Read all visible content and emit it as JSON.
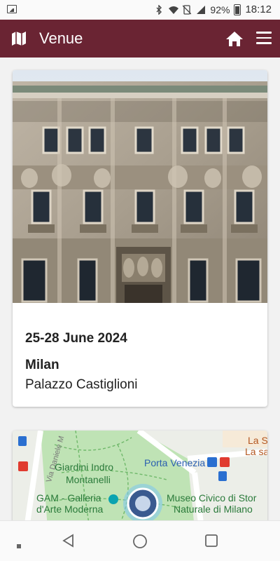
{
  "status_bar": {
    "battery": "92%",
    "time": "18:12",
    "icons": [
      "gallery-icon",
      "bluetooth-icon",
      "wifi-icon",
      "no-sim-icon",
      "signal-icon",
      "battery-icon"
    ]
  },
  "app_bar": {
    "title": "Venue",
    "color": "#6a2433",
    "left_icon": "map-icon",
    "right_icons": [
      "home-icon",
      "menu-icon"
    ]
  },
  "venue_card": {
    "date": "25-28 June 2024",
    "city": "Milan",
    "venue": "Palazzo Castiglioni"
  },
  "map": {
    "labels": {
      "street": "Via Daniele M",
      "park": "Giardini Indro Montanelli",
      "park_line1": "Giardini Indro",
      "park_line2": "Montanelli",
      "station": "Porta Venezia",
      "gallery_line1": "GAM - Galleria",
      "gallery_line2": "d'Arte Moderna",
      "museum_line1": "Museo Civico di Stor",
      "museum_line2": "Naturale di Milano",
      "corner_line1": "La Sc",
      "corner_line2": "La sa"
    }
  },
  "nav_bar": {
    "buttons": [
      "recents-indicator",
      "back-button",
      "home-button",
      "overview-button"
    ]
  }
}
